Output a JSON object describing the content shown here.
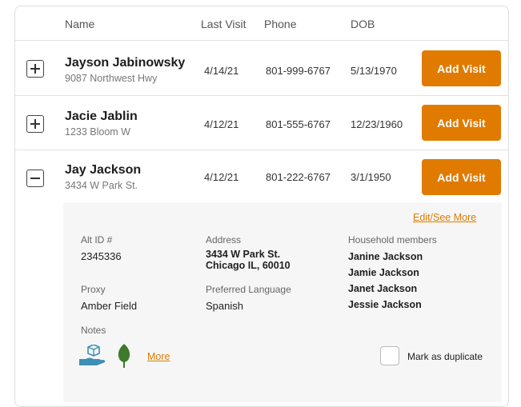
{
  "table": {
    "headers": {
      "name": "Name",
      "last_visit": "Last Visit",
      "phone": "Phone",
      "dob": "DOB"
    }
  },
  "rows": [
    {
      "name": "Jayson Jabinowsky",
      "address": "9087 Northwest Hwy",
      "last_visit": "4/14/21",
      "phone": "801-999-6767",
      "dob": "5/13/1970",
      "action_label": "Add Visit",
      "expanded": false
    },
    {
      "name": "Jacie Jablin",
      "address": "1233 Bloom W",
      "last_visit": "4/12/21",
      "phone": "801-555-6767",
      "dob": "12/23/1960",
      "action_label": "Add Visit",
      "expanded": false
    },
    {
      "name": "Jay Jackson",
      "address": "3434 W Park St.",
      "last_visit": "4/12/21",
      "phone": "801-222-6767",
      "dob": "3/1/1950",
      "action_label": "Add Visit",
      "expanded": true
    }
  ],
  "details": {
    "edit_link": "Edit/See More",
    "alt_id_label": "Alt ID #",
    "alt_id_value": "2345336",
    "address_label": "Address",
    "address_line1": "3434 W Park St.",
    "address_line2": "Chicago IL, 60010",
    "household_label": "Household members",
    "household_members": [
      "Janine Jackson",
      "Jamie Jackson",
      "Janet Jackson",
      "Jessie Jackson"
    ],
    "proxy_label": "Proxy",
    "proxy_value": "Amber Field",
    "language_label": "Preferred Language",
    "language_value": "Spanish",
    "notes_label": "Notes",
    "more_link": "More",
    "duplicate_label": "Mark as duplicate",
    "icons": [
      "hand-package-icon",
      "leaf-icon"
    ]
  },
  "colors": {
    "accent": "#e07b00",
    "detail_bg": "#f6f6f6",
    "icon_blue": "#3d8fb4",
    "icon_green": "#3e7a2a"
  }
}
